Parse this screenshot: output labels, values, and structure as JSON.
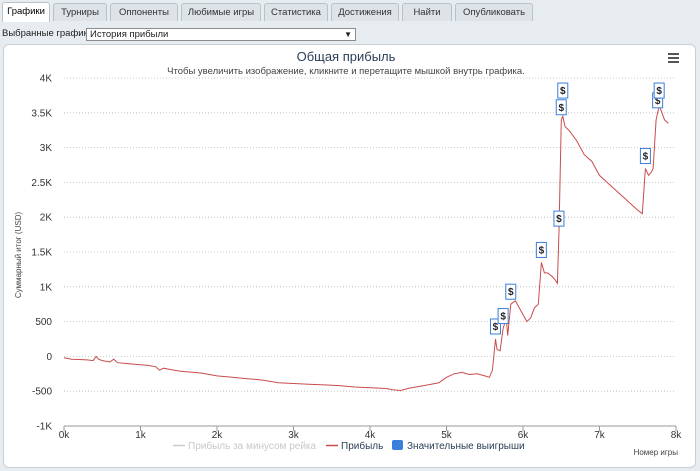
{
  "tabs": [
    "Графики",
    "Турниры",
    "Оппоненты",
    "Любимые игры",
    "Статистика",
    "Достижения",
    "Найти",
    "Опубликовать"
  ],
  "active_tab": 0,
  "selector": {
    "label": "Выбранные графики:",
    "value": "История прибыли"
  },
  "chart_data": {
    "type": "line",
    "title": "Общая прибыль",
    "subtitle": "Чтобы увеличить изображение, кликните и перетащите мышкой внутрь графика.",
    "xlabel": "Номер игры",
    "ylabel": "Суммарный итог (USD)",
    "xlim": [
      0,
      8000
    ],
    "ylim": [
      -1000,
      4000
    ],
    "x_ticks": [
      0,
      1000,
      2000,
      3000,
      4000,
      5000,
      6000,
      7000,
      8000
    ],
    "x_tick_labels": [
      "0k",
      "1k",
      "2k",
      "3k",
      "4k",
      "5k",
      "6k",
      "7k",
      "8k"
    ],
    "y_ticks": [
      -1000,
      -500,
      0,
      500,
      1000,
      1500,
      2000,
      2500,
      3000,
      3500,
      4000
    ],
    "y_tick_labels": [
      "-1K",
      "-500",
      "0",
      "500",
      "1K",
      "1.5K",
      "2K",
      "2.5K",
      "3K",
      "3.5K",
      "4K"
    ],
    "grid": true,
    "legend_position": "bottom",
    "series": [
      {
        "name": "Прибыль за минусом рейка",
        "visible": false,
        "color": "#cccccc",
        "points": []
      },
      {
        "name": "Прибыль",
        "color": "#c94c4c",
        "points": [
          [
            0,
            -20
          ],
          [
            100,
            -40
          ],
          [
            200,
            -45
          ],
          [
            300,
            -50
          ],
          [
            380,
            -60
          ],
          [
            420,
            0
          ],
          [
            450,
            -40
          ],
          [
            500,
            -60
          ],
          [
            600,
            -80
          ],
          [
            650,
            -40
          ],
          [
            700,
            -90
          ],
          [
            800,
            -100
          ],
          [
            900,
            -110
          ],
          [
            1000,
            -120
          ],
          [
            1100,
            -130
          ],
          [
            1200,
            -150
          ],
          [
            1250,
            -200
          ],
          [
            1300,
            -170
          ],
          [
            1400,
            -190
          ],
          [
            1500,
            -210
          ],
          [
            1600,
            -220
          ],
          [
            1700,
            -230
          ],
          [
            1800,
            -240
          ],
          [
            1900,
            -260
          ],
          [
            2000,
            -280
          ],
          [
            2200,
            -300
          ],
          [
            2400,
            -320
          ],
          [
            2600,
            -340
          ],
          [
            2800,
            -380
          ],
          [
            3000,
            -390
          ],
          [
            3200,
            -400
          ],
          [
            3400,
            -410
          ],
          [
            3600,
            -420
          ],
          [
            3800,
            -440
          ],
          [
            4000,
            -450
          ],
          [
            4200,
            -460
          ],
          [
            4300,
            -480
          ],
          [
            4400,
            -490
          ],
          [
            4500,
            -460
          ],
          [
            4600,
            -440
          ],
          [
            4700,
            -420
          ],
          [
            4800,
            -400
          ],
          [
            4900,
            -380
          ],
          [
            5000,
            -300
          ],
          [
            5100,
            -250
          ],
          [
            5200,
            -230
          ],
          [
            5300,
            -260
          ],
          [
            5400,
            -250
          ],
          [
            5500,
            -280
          ],
          [
            5560,
            -300
          ],
          [
            5600,
            -200
          ],
          [
            5640,
            250
          ],
          [
            5660,
            100
          ],
          [
            5700,
            80
          ],
          [
            5740,
            400
          ],
          [
            5780,
            550
          ],
          [
            5800,
            300
          ],
          [
            5840,
            750
          ],
          [
            5900,
            800
          ],
          [
            5950,
            700
          ],
          [
            6000,
            600
          ],
          [
            6050,
            500
          ],
          [
            6100,
            550
          ],
          [
            6150,
            700
          ],
          [
            6200,
            750
          ],
          [
            6240,
            1350
          ],
          [
            6280,
            1200
          ],
          [
            6320,
            1200
          ],
          [
            6380,
            1150
          ],
          [
            6420,
            1100
          ],
          [
            6450,
            1050
          ],
          [
            6470,
            1800
          ],
          [
            6500,
            3400
          ],
          [
            6520,
            3450
          ],
          [
            6550,
            3300
          ],
          [
            6600,
            3250
          ],
          [
            6700,
            3100
          ],
          [
            6800,
            2900
          ],
          [
            6900,
            2800
          ],
          [
            7000,
            2600
          ],
          [
            7100,
            2500
          ],
          [
            7200,
            2400
          ],
          [
            7300,
            2300
          ],
          [
            7400,
            2200
          ],
          [
            7500,
            2100
          ],
          [
            7560,
            2050
          ],
          [
            7600,
            2700
          ],
          [
            7640,
            2600
          ],
          [
            7680,
            2650
          ],
          [
            7700,
            2700
          ],
          [
            7740,
            3400
          ],
          [
            7760,
            3500
          ],
          [
            7780,
            3600
          ],
          [
            7800,
            3550
          ],
          [
            7850,
            3400
          ],
          [
            7900,
            3350
          ]
        ]
      }
    ],
    "markers": {
      "name": "Значительные выигрыши",
      "color": "#3a7fd9",
      "symbol": "$",
      "points": [
        [
          5640,
          250
        ],
        [
          5740,
          400
        ],
        [
          5840,
          750
        ],
        [
          6240,
          1350
        ],
        [
          6470,
          1800
        ],
        [
          6500,
          3400
        ],
        [
          6520,
          3640
        ],
        [
          7600,
          2700
        ],
        [
          7760,
          3500
        ],
        [
          7780,
          3640
        ]
      ]
    }
  }
}
